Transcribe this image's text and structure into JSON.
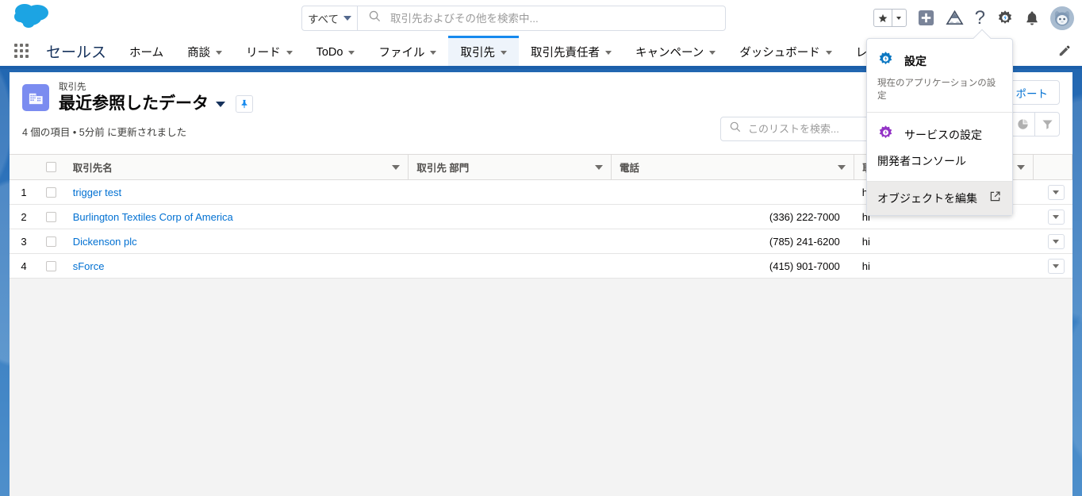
{
  "header": {
    "logo": "salesforce-cloud-logo",
    "search": {
      "scope_label": "すべて",
      "scope_icon": "chevron-down-icon",
      "search_icon": "search-icon",
      "placeholder": "取引先およびその他を検索中..."
    },
    "actions": [
      {
        "name": "favorites-star",
        "icon": "star-icon"
      },
      {
        "name": "favorites-caret",
        "icon": "chevron-down-icon"
      },
      {
        "name": "add-favorite",
        "icon": "plus-square-icon"
      },
      {
        "name": "guidance",
        "icon": "mountain-icon"
      },
      {
        "name": "help",
        "icon": "question-mark-icon"
      },
      {
        "name": "setup",
        "icon": "gear-icon"
      },
      {
        "name": "notifications",
        "icon": "bell-icon"
      },
      {
        "name": "user-profile",
        "icon": "avatar-icon"
      }
    ]
  },
  "nav": {
    "app_launcher_icon": "waffle-grid-icon",
    "app_name": "セールス",
    "edit_icon": "pencil-icon",
    "items": [
      {
        "label": "ホーム",
        "has_menu": false,
        "active": false
      },
      {
        "label": "商談",
        "has_menu": true,
        "active": false
      },
      {
        "label": "リード",
        "has_menu": true,
        "active": false
      },
      {
        "label": "ToDo",
        "has_menu": true,
        "active": false
      },
      {
        "label": "ファイル",
        "has_menu": true,
        "active": false
      },
      {
        "label": "取引先",
        "has_menu": true,
        "active": true
      },
      {
        "label": "取引先責任者",
        "has_menu": true,
        "active": false
      },
      {
        "label": "キャンペーン",
        "has_menu": true,
        "active": false
      },
      {
        "label": "ダッシュボード",
        "has_menu": true,
        "active": false
      },
      {
        "label": "レポ",
        "has_menu": false,
        "active": false
      }
    ]
  },
  "list_view": {
    "object_icon": "account-building-icon",
    "object_label": "取引先",
    "name": "最近参照したデータ",
    "name_caret_icon": "chevron-down-icon",
    "pin_icon": "pin-icon",
    "meta": "4 個の項目 • 5分前 に更新されました",
    "import_button": "ポート",
    "chart_icon": "chart-pie-icon",
    "filter_icon": "filter-icon",
    "search": {
      "icon": "search-icon",
      "placeholder": "このリストを検索..."
    }
  },
  "table": {
    "select_all_icon": "checkbox-icon",
    "columns": [
      {
        "label": "取引先名",
        "sortable": true
      },
      {
        "label": "取引先 部門",
        "sortable": true
      },
      {
        "label": "電話",
        "sortable": true
      },
      {
        "label": "取引",
        "sortable": true
      }
    ],
    "rows": [
      {
        "num": "1",
        "name": "trigger test",
        "dept": "",
        "phone": "",
        "owner": "hi"
      },
      {
        "num": "2",
        "name": "Burlington Textiles Corp of America",
        "dept": "",
        "phone": "(336) 222-7000",
        "owner": "hi"
      },
      {
        "num": "3",
        "name": "Dickenson plc",
        "dept": "",
        "phone": "(785) 241-6200",
        "owner": "hi"
      },
      {
        "num": "4",
        "name": "sForce",
        "dept": "",
        "phone": "(415) 901-7000",
        "owner": "hi"
      }
    ],
    "row_menu_icon": "chevron-down-icon"
  },
  "setup_menu": {
    "primary": {
      "icon": "gear-icon-blue",
      "label": "設定",
      "sublabel": "現在のアプリケーションの設定"
    },
    "items": [
      {
        "icon": "gear-icon-purple",
        "label": "サービスの設定"
      },
      {
        "icon": "",
        "label": "開発者コンソール"
      }
    ],
    "footer": {
      "label": "オブジェクトを編集",
      "icon": "external-link-icon"
    }
  },
  "colors": {
    "brand_blue": "#1b5faa",
    "link_blue": "#0070d2",
    "active_tab_blue": "#1589ee",
    "object_icon_purple": "#7b8cf0",
    "gear_blue": "#0b77c2",
    "gear_purple": "#9333c6"
  }
}
